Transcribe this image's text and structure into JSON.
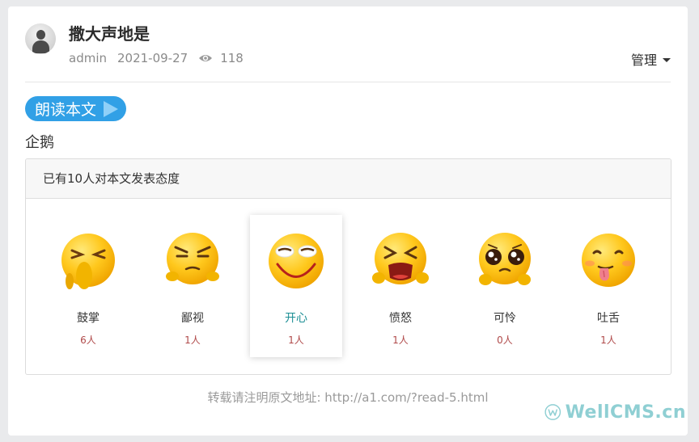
{
  "post": {
    "title": "撒大声地是",
    "author": "admin",
    "date": "2021-09-27",
    "views": "118",
    "manage_label": "管理"
  },
  "read_button": {
    "label": "朗读本文"
  },
  "content": {
    "text": "企鹅"
  },
  "reactions": {
    "summary": "已有10人对本文发表态度",
    "items": [
      {
        "label": "鼓掌",
        "count": "6人",
        "icon": "clapping-emoji-icon"
      },
      {
        "label": "鄙视",
        "count": "1人",
        "icon": "contempt-emoji-icon"
      },
      {
        "label": "开心",
        "count": "1人",
        "icon": "happy-emoji-icon",
        "selected": true
      },
      {
        "label": "愤怒",
        "count": "1人",
        "icon": "angry-emoji-icon"
      },
      {
        "label": "可怜",
        "count": "0人",
        "icon": "pitiful-emoji-icon"
      },
      {
        "label": "吐舌",
        "count": "1人",
        "icon": "tongue-out-emoji-icon"
      }
    ]
  },
  "footer": {
    "note": "转载请注明原文地址: http://a1.com/?read-5.html",
    "brand": "WellCMS.cn"
  },
  "colors": {
    "read_button": "#31a0e6",
    "active_label": "#1d8f95",
    "count_text": "#b04a4a"
  }
}
